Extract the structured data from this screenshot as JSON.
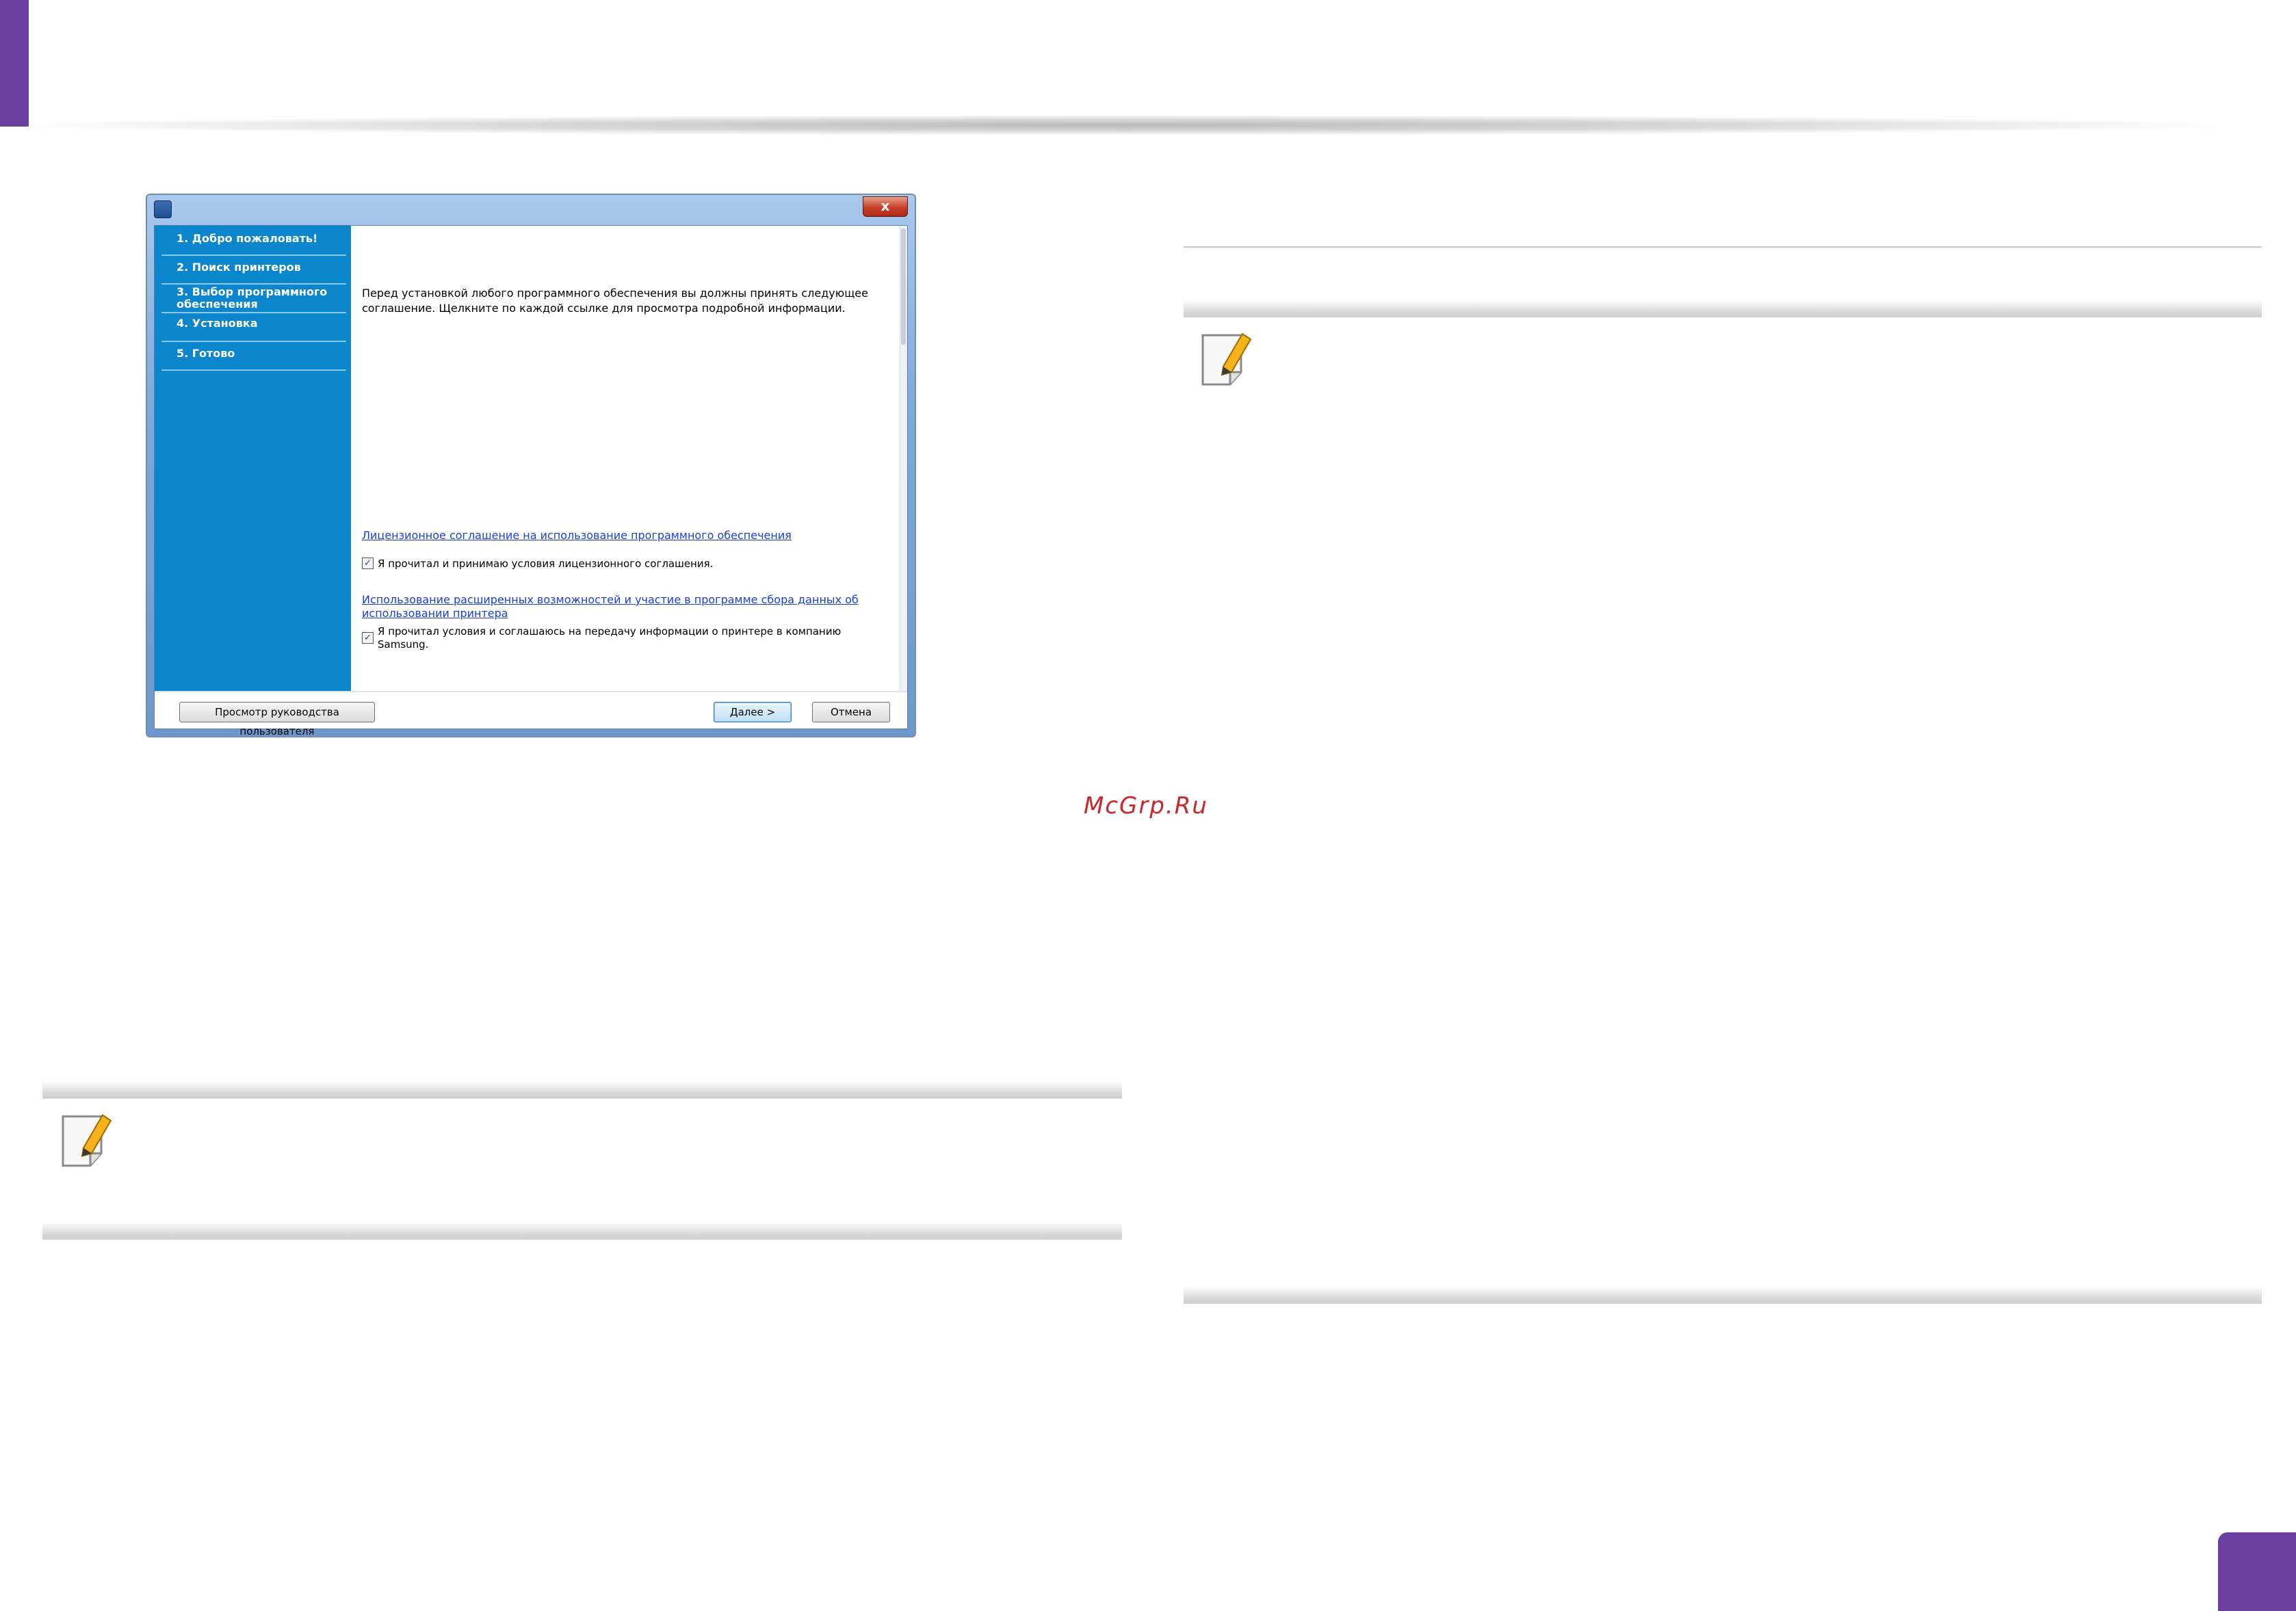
{
  "installer": {
    "close_label": "x",
    "steps": [
      "1. Добро пожаловать!",
      "2. Поиск принтеров",
      "3. Выбор программного обеспечения",
      "4. Установка",
      "5. Готово"
    ],
    "intro_text": "Перед установкой любого программного обеспечения вы должны принять следующее соглашение. Щелкните по каждой ссылке для просмотра подробной информации.",
    "license_link": "Лицензионное соглашение на использование программного обеспечения",
    "license_checkbox": "Я прочитал и принимаю условия лицензионного соглашения.",
    "usage_link": "Использование расширенных возможностей и участие в программе сбора данных об использовании принтера",
    "usage_checkbox": "Я прочитал условия и соглашаюсь на передачу информации о принтере в компанию Samsung.",
    "checkmark": "✓",
    "buttons": {
      "user_guide": "Просмотр руководства пользователя",
      "next": "Далее >",
      "cancel": "Отмена"
    }
  },
  "watermark": "McGrp.Ru"
}
